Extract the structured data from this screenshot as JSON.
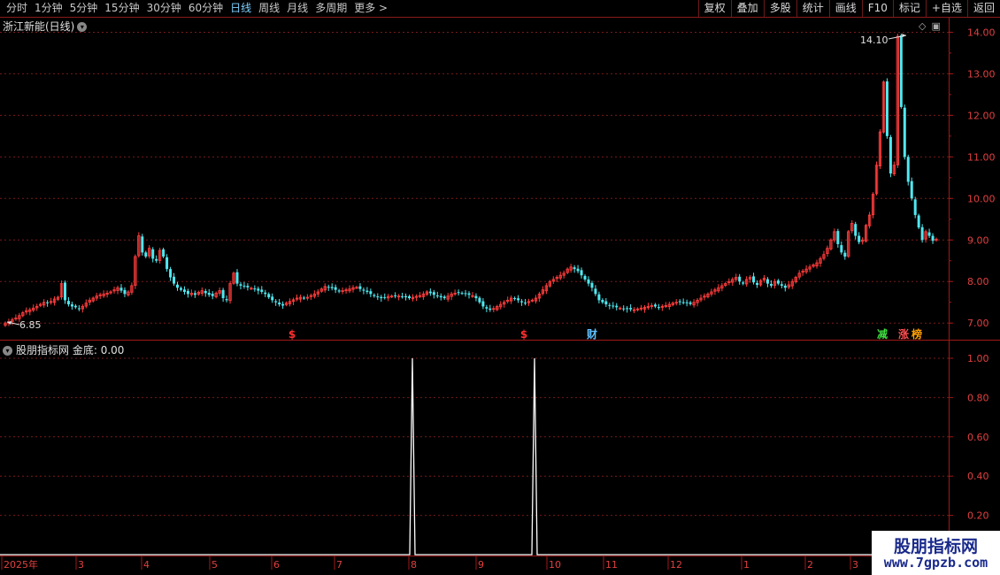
{
  "toolbar": {
    "periods": [
      "分时",
      "1分钟",
      "5分钟",
      "15分钟",
      "30分钟",
      "60分钟",
      "日线",
      "周线",
      "月线",
      "多周期",
      "更多 >"
    ],
    "active_period": "日线",
    "actions": [
      "复权",
      "叠加",
      "多股",
      "统计",
      "画线",
      "F10",
      "标记",
      "+自选",
      "返回"
    ]
  },
  "main_chart": {
    "stock_name": "浙江新能(日线)",
    "high_label": "14.10",
    "low_label": "6.85",
    "y_ticks": [
      "14.00",
      "13.00",
      "12.00",
      "11.00",
      "10.00",
      "9.00",
      "8.00",
      "7.00"
    ],
    "markers": [
      {
        "text": "$",
        "color": "#ff3030"
      },
      {
        "text": "$",
        "color": "#ff3030"
      },
      {
        "text": "财",
        "color": "#60c0ff"
      },
      {
        "text": "减",
        "color": "#40e040"
      },
      {
        "text": "涨",
        "color": "#ff5050"
      },
      {
        "text": "榜",
        "color": "#ffa000"
      }
    ]
  },
  "indicator": {
    "title": "股朋指标网",
    "value_label": "金底: 0.00",
    "y_ticks": [
      "1.00",
      "0.80",
      "0.60",
      "0.40",
      "0.20"
    ]
  },
  "time_axis": [
    "2025年",
    "3",
    "4",
    "5",
    "6",
    "7",
    "8",
    "9",
    "10",
    "11",
    "12",
    "1",
    "2",
    "3"
  ],
  "watermark": {
    "title": "股朋指标网",
    "url": "www.7gpzb.com"
  },
  "chart_data": {
    "type": "candlestick",
    "price_range": [
      6.6,
      14.35
    ],
    "close_series": [
      7.0,
      7.03,
      7.08,
      7.12,
      7.18,
      7.25,
      7.3,
      7.32,
      7.36,
      7.4,
      7.45,
      7.5,
      7.48,
      7.52,
      7.58,
      7.62,
      7.95,
      7.55,
      7.45,
      7.4,
      7.38,
      7.35,
      7.4,
      7.48,
      7.55,
      7.6,
      7.65,
      7.68,
      7.7,
      7.72,
      7.75,
      7.8,
      7.85,
      7.78,
      7.7,
      7.75,
      7.9,
      8.6,
      9.1,
      8.7,
      8.6,
      8.8,
      8.55,
      8.5,
      8.75,
      8.6,
      8.3,
      8.1,
      7.95,
      7.85,
      7.8,
      7.75,
      7.7,
      7.72,
      7.68,
      7.74,
      7.78,
      7.72,
      7.68,
      7.65,
      7.72,
      7.78,
      7.6,
      7.55,
      7.95,
      8.2,
      7.95,
      7.9,
      7.88,
      7.86,
      7.84,
      7.82,
      7.78,
      7.75,
      7.7,
      7.62,
      7.55,
      7.5,
      7.45,
      7.42,
      7.48,
      7.52,
      7.56,
      7.6,
      7.62,
      7.6,
      7.62,
      7.66,
      7.7,
      7.75,
      7.82,
      7.88,
      7.86,
      7.84,
      7.8,
      7.76,
      7.78,
      7.8,
      7.82,
      7.85,
      7.86,
      7.82,
      7.78,
      7.75,
      7.7,
      7.65,
      7.62,
      7.6,
      7.62,
      7.64,
      7.65,
      7.66,
      7.65,
      7.64,
      7.62,
      7.6,
      7.62,
      7.64,
      7.66,
      7.7,
      7.75,
      7.72,
      7.68,
      7.65,
      7.62,
      7.6,
      7.65,
      7.7,
      7.72,
      7.74,
      7.72,
      7.7,
      7.68,
      7.66,
      7.6,
      7.5,
      7.4,
      7.35,
      7.32,
      7.35,
      7.4,
      7.45,
      7.5,
      7.55,
      7.6,
      7.58,
      7.55,
      7.5,
      7.48,
      7.52,
      7.55,
      7.6,
      7.7,
      7.8,
      7.9,
      8.0,
      8.05,
      8.1,
      8.15,
      8.2,
      8.3,
      8.35,
      8.3,
      8.25,
      8.15,
      8.05,
      7.95,
      7.85,
      7.7,
      7.55,
      7.5,
      7.45,
      7.42,
      7.4,
      7.38,
      7.36,
      7.35,
      7.34,
      7.33,
      7.32,
      7.34,
      7.36,
      7.38,
      7.4,
      7.42,
      7.4,
      7.38,
      7.4,
      7.42,
      7.45,
      7.48,
      7.5,
      7.52,
      7.5,
      7.48,
      7.46,
      7.5,
      7.55,
      7.6,
      7.65,
      7.7,
      7.75,
      7.8,
      7.85,
      7.9,
      7.95,
      8.0,
      8.05,
      8.1,
      8.0,
      7.95,
      8.05,
      8.1,
      7.98,
      7.92,
      8.02,
      8.08,
      7.95,
      7.9,
      8.0,
      7.95,
      7.9,
      7.85,
      7.92,
      8.0,
      8.1,
      8.2,
      8.25,
      8.3,
      8.35,
      8.4,
      8.45,
      8.55,
      8.65,
      8.8,
      9.0,
      9.2,
      8.9,
      8.7,
      8.6,
      9.2,
      9.4,
      9.1,
      8.95,
      9.0,
      9.35,
      9.6,
      10.1,
      10.8,
      11.6,
      12.8,
      11.5,
      10.6,
      10.8,
      13.9,
      12.2,
      11.0,
      10.4,
      10.0,
      9.6,
      9.3,
      9.0,
      9.2,
      9.1,
      8.98,
      9.02
    ],
    "indicator_series": {
      "name": "金底",
      "spikes": [
        {
          "month": "8",
          "value": 1.0
        },
        {
          "month": "9",
          "value": 1.0
        }
      ],
      "baseline": 0.0
    }
  }
}
